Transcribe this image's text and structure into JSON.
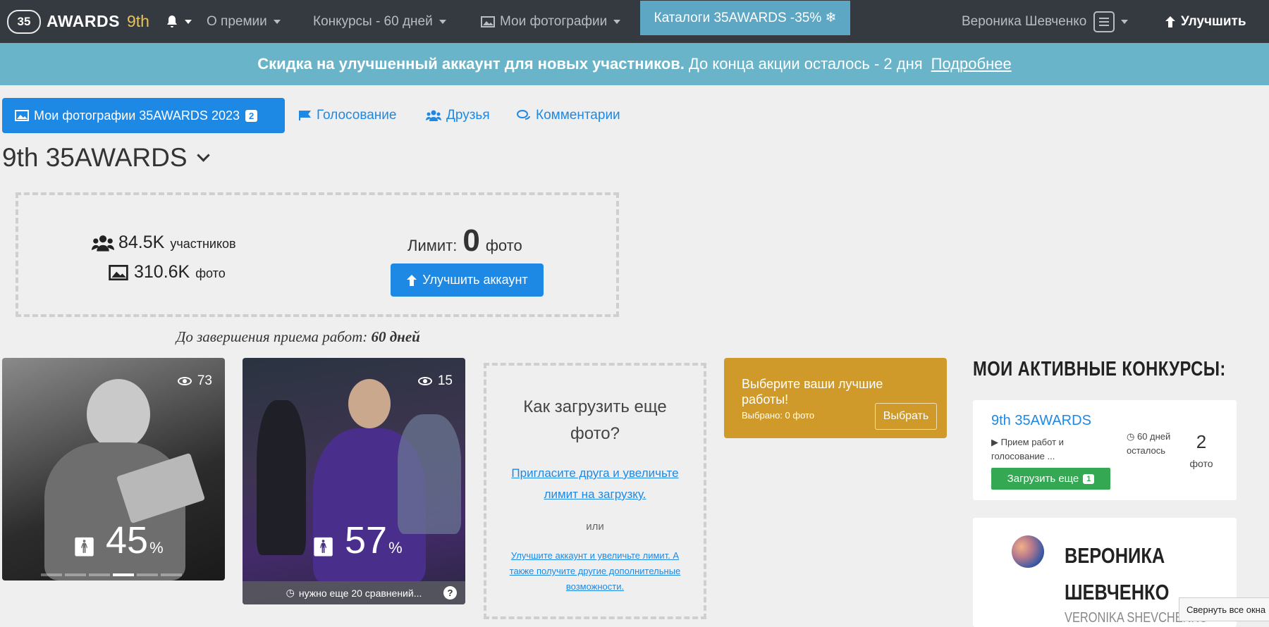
{
  "navbar": {
    "logo_text": "35",
    "brand": "AWARDS",
    "edition": "9th",
    "bell_icon": "bell-icon",
    "menu1": "О премии",
    "menu2": "Конкурсы - 60 дней",
    "menu3": "Мои фотографии",
    "menu4": "Каталоги 35AWARDS -35% ❄",
    "user": "Вероника Шевченко",
    "upgrade": "Улучшить"
  },
  "banner": {
    "bold": "Скидка на улучшенный аккаунт для новых участников.",
    "text": "До конца акции осталось - 2 дня",
    "link": "Подробнее"
  },
  "tabs": {
    "active": "Мои фотографии 35AWARDS 2023",
    "active_badge": "2",
    "voting": "Голосование",
    "friends": "Друзья",
    "comments": "Комментарии"
  },
  "contest_title": "9th 35AWARDS",
  "stats": {
    "participants_value": "84.5K",
    "participants_label": "участников",
    "photos_value": "310.6K",
    "photos_label": "фото",
    "limit_label": "Лимит:",
    "limit_value": "0",
    "limit_unit": "фото",
    "upgrade_button": "Улучшить аккаунт"
  },
  "deadline": {
    "label": "До завершения приема работ:",
    "value": "60 дней"
  },
  "photos": [
    {
      "views": "73",
      "percent": "45",
      "percent_sign": "%"
    },
    {
      "views": "15",
      "percent": "57",
      "percent_sign": "%",
      "need_text": "нужно еще 20 сравнений...",
      "help": "?"
    }
  ],
  "how_to": {
    "title": "Как загрузить еще фото?",
    "invite_link": "Пригласите друга и увеличьте лимит на загрузку.",
    "or": "или",
    "upgrade_link": "Улучшите аккаунт и увеличьте лимит. А также получите другие дополнительные возможности."
  },
  "choose_best": {
    "title": "Выберите ваши лучшие работы!",
    "selected": "Выбрано: 0 фото",
    "button": "Выбрать"
  },
  "sidebar": {
    "heading": "МОИ АКТИВНЫЕ КОНКУРСЫ:",
    "contest": {
      "title": "9th 35AWARDS",
      "status": "▶ Прием работ и голосование ...",
      "days": "60 дней осталось",
      "count": "2",
      "count_label": "фото",
      "upload_button": "Загрузить еще",
      "upload_badge": "1"
    },
    "profile": {
      "name": "ВЕРОНИКА ШЕВЧЕНКО",
      "latin": "VERONIKA SHEVCHENKO"
    }
  },
  "tooltip": "Свернуть все окна",
  "colors": {
    "navbar": "#343a40",
    "banner": "#69b4c9",
    "primary": "#1e88e5",
    "gold": "#d09a2a",
    "green": "#34a853"
  }
}
